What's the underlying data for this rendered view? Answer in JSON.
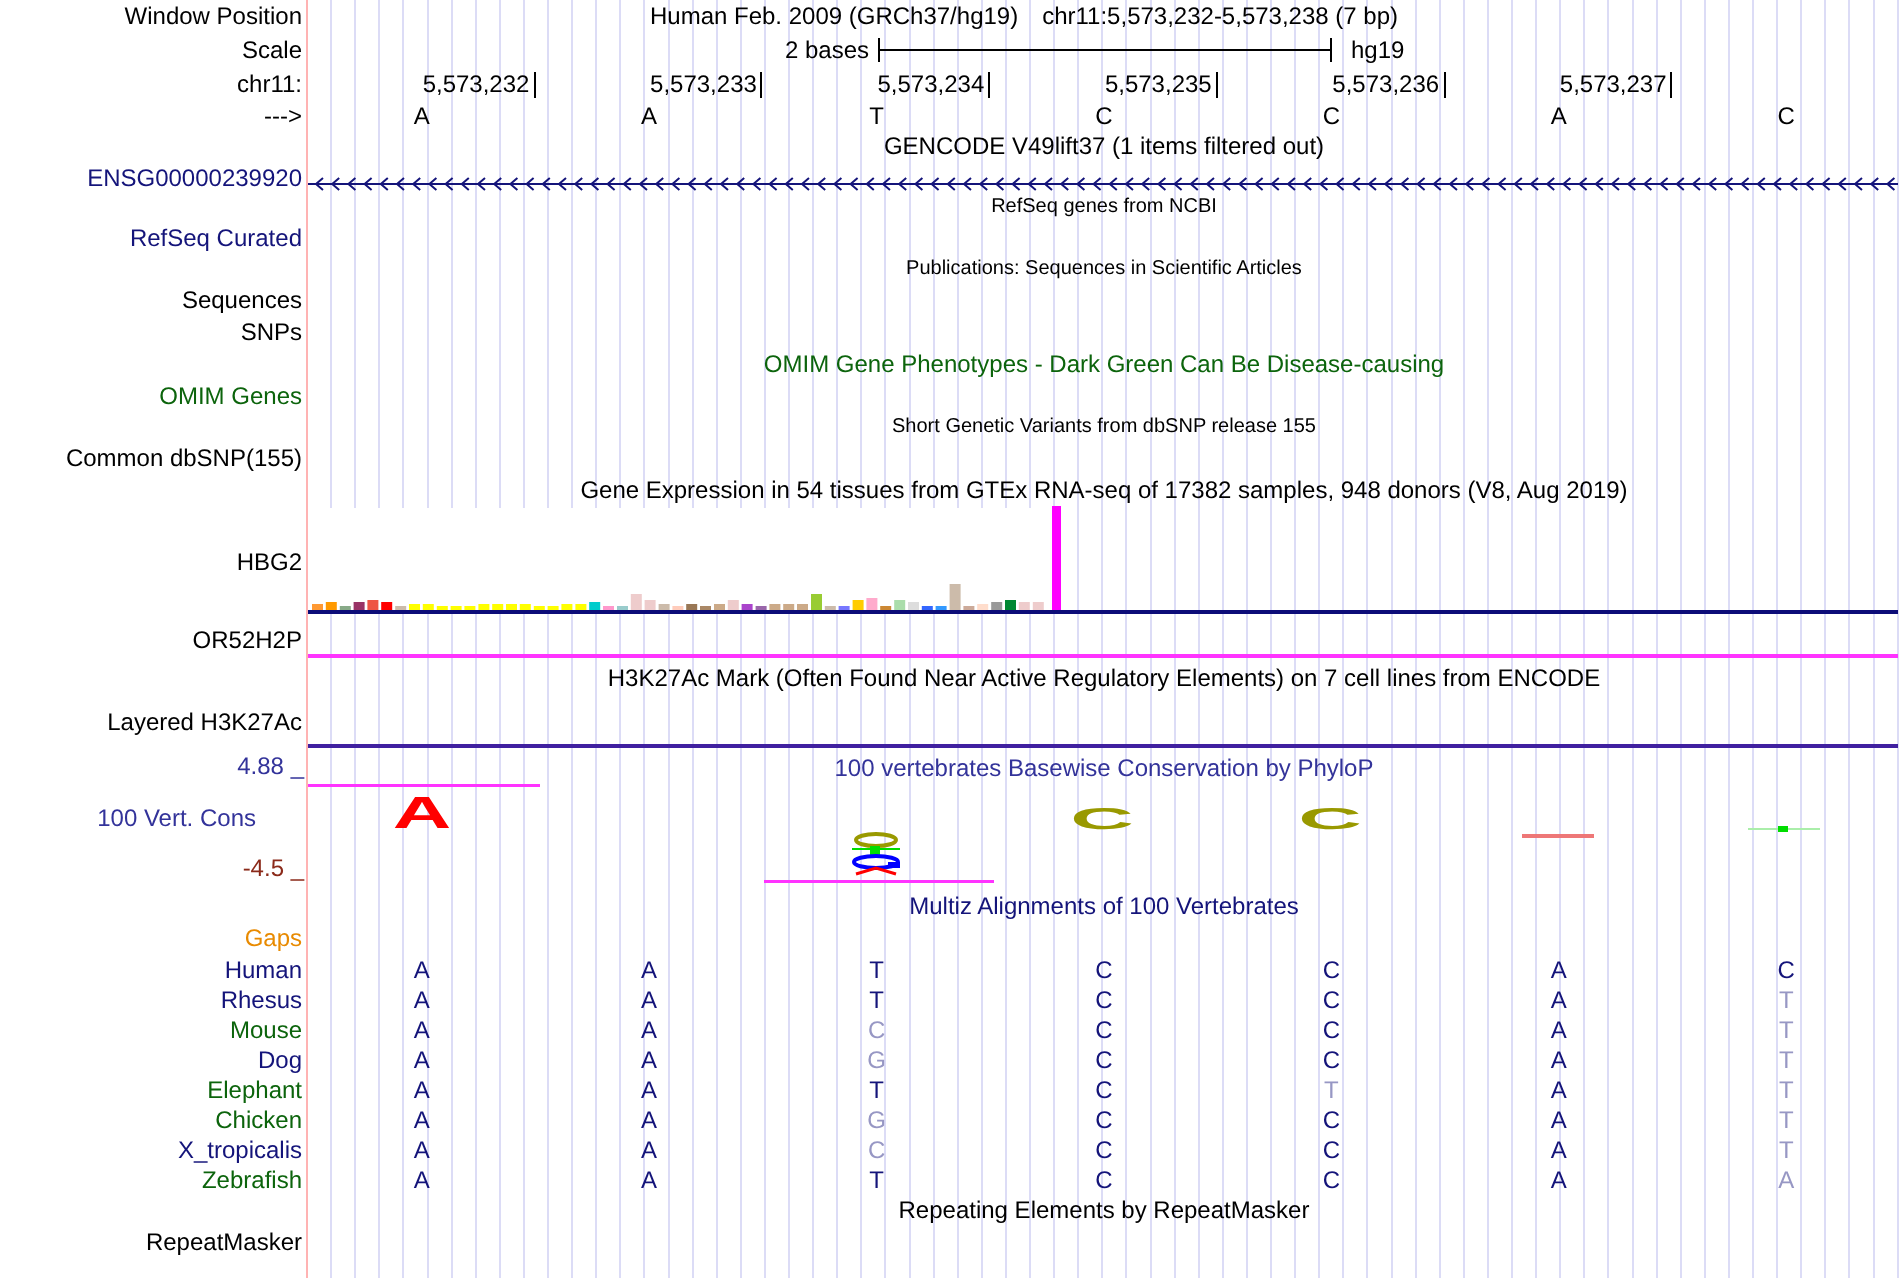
{
  "header": {
    "label": "Window Position",
    "title": "Human Feb. 2009 (GRCh37/hg19)",
    "position": "chr11:5,573,232-5,573,238 (7 bp)"
  },
  "scale": {
    "label": "Scale",
    "text": "2 bases",
    "assembly": "hg19"
  },
  "ruler": {
    "label": "chr11:",
    "positions": [
      "5,573,232",
      "5,573,233",
      "5,573,234",
      "5,573,235",
      "5,573,236",
      "5,573,237"
    ]
  },
  "strand": {
    "label": "--->",
    "bases": [
      "A",
      "A",
      "T",
      "C",
      "C",
      "A",
      "C"
    ]
  },
  "rows": [
    {
      "kind": "title",
      "text": "GENCODE V49lift37 (1 items filtered out)",
      "color": "#000000"
    },
    {
      "kind": "gene",
      "label": "ENSG00000239920",
      "color": "#14147a"
    },
    {
      "kind": "subtitle",
      "text": "RefSeq genes from NCBI"
    },
    {
      "kind": "blank",
      "label": "RefSeq Curated",
      "color": "#14147a"
    },
    {
      "kind": "subtitle",
      "text": "Publications: Sequences in Scientific Articles"
    },
    {
      "kind": "blank",
      "label": "Sequences",
      "color": "#000000"
    },
    {
      "kind": "blank",
      "label": "SNPs",
      "color": "#000000"
    },
    {
      "kind": "title",
      "text": "OMIM Gene Phenotypes - Dark Green Can Be Disease-causing",
      "color": "#0c640c"
    },
    {
      "kind": "blank",
      "label": "OMIM Genes",
      "color": "#0c640c"
    },
    {
      "kind": "subtitle",
      "text": "Short Genetic Variants from dbSNP release 155"
    },
    {
      "kind": "blank",
      "label": "Common dbSNP(155)",
      "color": "#000000"
    },
    {
      "kind": "title",
      "text": "Gene Expression in 54 tissues from GTEx RNA-seq of 17382 samples, 948 donors (V8, Aug 2019)",
      "color": "#000000"
    },
    {
      "kind": "expression",
      "label": "HBG2",
      "color": "#000000"
    },
    {
      "kind": "pseudogene",
      "label": "OR52H2P",
      "color": "#000000"
    },
    {
      "kind": "title",
      "text": "H3K27Ac Mark (Often Found Near Active Regulatory Elements) on 7 cell lines from ENCODE",
      "color": "#000000"
    },
    {
      "kind": "signal",
      "label": "Layered H3K27Ac",
      "color": "#000000"
    },
    {
      "kind": "conservation",
      "title": "100 vertebrates Basewise Conservation by PhyloP",
      "label": "100 Vert. Cons",
      "max": "4.88 _",
      "min": "-4.5 _",
      "color": "#33339a",
      "logo": [
        {
          "kind": "letter",
          "base": "A",
          "color": "#ff0000"
        },
        {
          "kind": "blank"
        },
        {
          "kind": "stack"
        },
        {
          "kind": "letter",
          "base": "C",
          "color": "#999900"
        },
        {
          "kind": "letter",
          "base": "C",
          "color": "#999900"
        },
        {
          "kind": "dash"
        },
        {
          "kind": "tick"
        }
      ]
    },
    {
      "kind": "title",
      "text": "Multiz Alignments of 100 Vertebrates",
      "color": "#14147a"
    },
    {
      "kind": "blank",
      "label": "Gaps",
      "color": "#e88a00"
    },
    {
      "kind": "species",
      "label": "Human",
      "color": "#14147a",
      "bases": [
        {
          "base": "A",
          "differs": false
        },
        {
          "base": "A",
          "differs": false
        },
        {
          "base": "T",
          "differs": false
        },
        {
          "base": "C",
          "differs": false
        },
        {
          "base": "C",
          "differs": false
        },
        {
          "base": "A",
          "differs": false
        },
        {
          "base": "C",
          "differs": false
        }
      ]
    },
    {
      "kind": "species",
      "label": "Rhesus",
      "color": "#14147a",
      "bases": [
        {
          "base": "A",
          "differs": false
        },
        {
          "base": "A",
          "differs": false
        },
        {
          "base": "T",
          "differs": false
        },
        {
          "base": "C",
          "differs": false
        },
        {
          "base": "C",
          "differs": false
        },
        {
          "base": "A",
          "differs": false
        },
        {
          "base": "T",
          "differs": true
        }
      ]
    },
    {
      "kind": "species",
      "label": "Mouse",
      "color": "#0c640c",
      "bases": [
        {
          "base": "A",
          "differs": false
        },
        {
          "base": "A",
          "differs": false
        },
        {
          "base": "C",
          "differs": true
        },
        {
          "base": "C",
          "differs": false
        },
        {
          "base": "C",
          "differs": false
        },
        {
          "base": "A",
          "differs": false
        },
        {
          "base": "T",
          "differs": true
        }
      ]
    },
    {
      "kind": "species",
      "label": "Dog",
      "color": "#14147a",
      "bases": [
        {
          "base": "A",
          "differs": false
        },
        {
          "base": "A",
          "differs": false
        },
        {
          "base": "G",
          "differs": true
        },
        {
          "base": "C",
          "differs": false
        },
        {
          "base": "C",
          "differs": false
        },
        {
          "base": "A",
          "differs": false
        },
        {
          "base": "T",
          "differs": true
        }
      ]
    },
    {
      "kind": "species",
      "label": "Elephant",
      "color": "#0c640c",
      "bases": [
        {
          "base": "A",
          "differs": false
        },
        {
          "base": "A",
          "differs": false
        },
        {
          "base": "T",
          "differs": false
        },
        {
          "base": "C",
          "differs": false
        },
        {
          "base": "T",
          "differs": true
        },
        {
          "base": "A",
          "differs": false
        },
        {
          "base": "T",
          "differs": true
        }
      ]
    },
    {
      "kind": "species",
      "label": "Chicken",
      "color": "#0c640c",
      "bases": [
        {
          "base": "A",
          "differs": false
        },
        {
          "base": "A",
          "differs": false
        },
        {
          "base": "G",
          "differs": true
        },
        {
          "base": "C",
          "differs": false
        },
        {
          "base": "C",
          "differs": false
        },
        {
          "base": "A",
          "differs": false
        },
        {
          "base": "T",
          "differs": true
        }
      ]
    },
    {
      "kind": "species",
      "label": "X_tropicalis",
      "color": "#14147a",
      "bases": [
        {
          "base": "A",
          "differs": false
        },
        {
          "base": "A",
          "differs": false
        },
        {
          "base": "C",
          "differs": true
        },
        {
          "base": "C",
          "differs": false
        },
        {
          "base": "C",
          "differs": false
        },
        {
          "base": "A",
          "differs": false
        },
        {
          "base": "T",
          "differs": true
        }
      ]
    },
    {
      "kind": "species",
      "label": "Zebrafish",
      "color": "#0c640c",
      "bases": [
        {
          "base": "A",
          "differs": false
        },
        {
          "base": "A",
          "differs": false
        },
        {
          "base": "T",
          "differs": false
        },
        {
          "base": "C",
          "differs": false
        },
        {
          "base": "C",
          "differs": false
        },
        {
          "base": "A",
          "differs": false
        },
        {
          "base": "A",
          "differs": true
        }
      ]
    },
    {
      "kind": "title",
      "text": "Repeating Elements by RepeatMasker",
      "color": "#000000"
    },
    {
      "kind": "blank",
      "label": "RepeatMasker",
      "color": "#000000"
    }
  ]
}
